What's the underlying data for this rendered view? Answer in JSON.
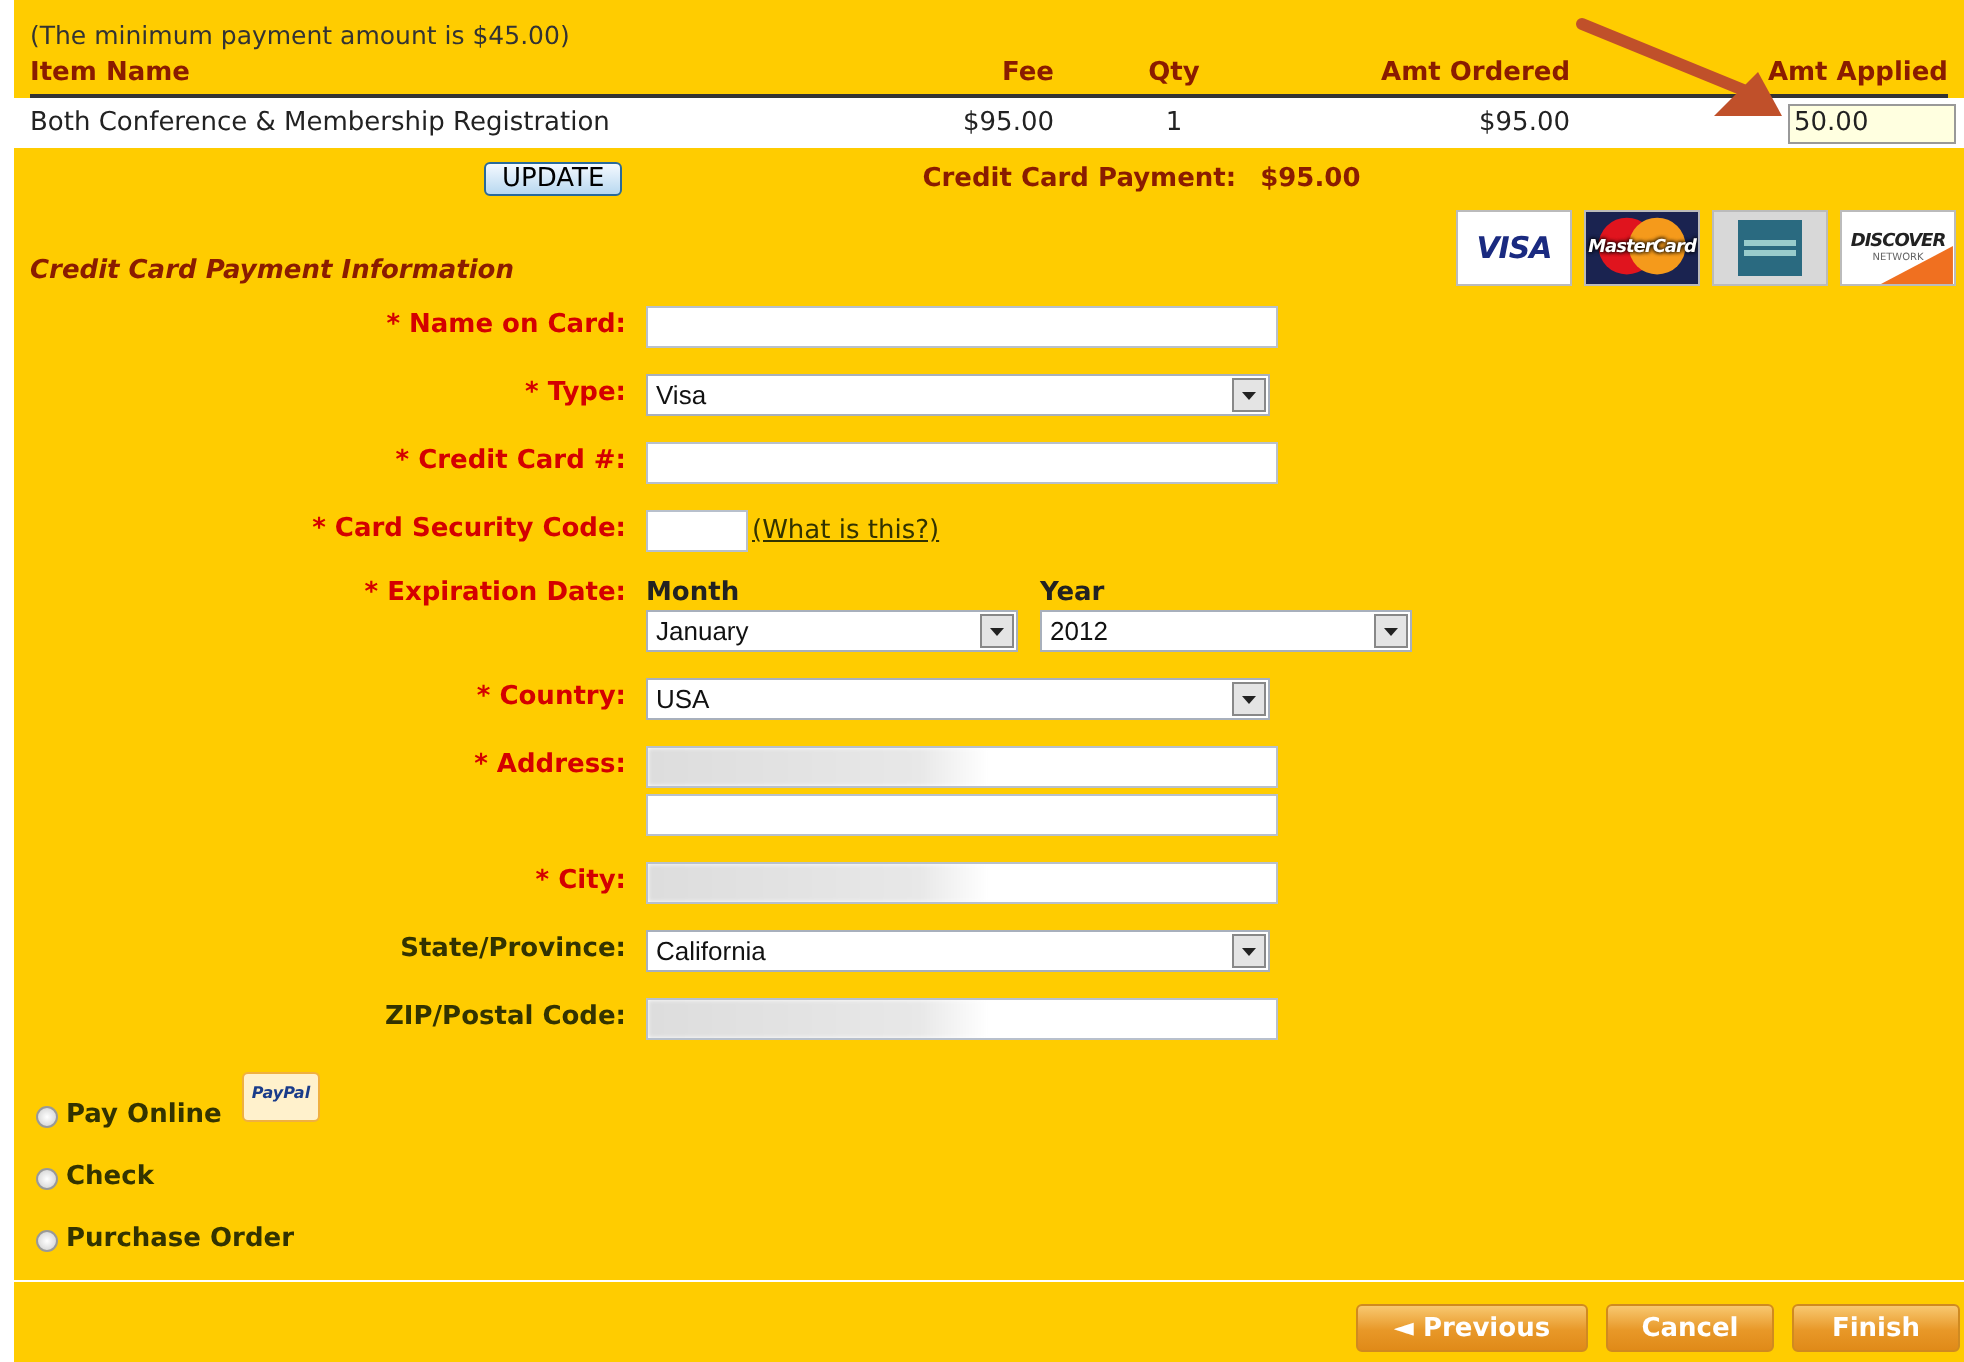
{
  "note": "(The minimum payment amount is $45.00)",
  "table": {
    "columns": [
      "Item Name",
      "Fee",
      "Qty",
      "Amt Ordered",
      "Amt Applied"
    ],
    "rows": [
      {
        "item": "Both Conference & Membership Registration",
        "fee": "$95.00",
        "qty": "1",
        "amt_ordered": "$95.00",
        "amt_applied": "50.00"
      }
    ]
  },
  "update_button": "UPDATE",
  "credit_card_payment": {
    "label": "Credit Card Payment:",
    "amount": "$95.00"
  },
  "card_logos": [
    {
      "kind": "visa",
      "text": "VISA"
    },
    {
      "kind": "mastercard",
      "text": "MasterCard"
    },
    {
      "kind": "amex"
    },
    {
      "kind": "discover",
      "text": "DISCOVER",
      "subtext": "NETWORK"
    }
  ],
  "section_title": "Credit Card Payment Information",
  "form": [
    {
      "kind": "text",
      "label": "* Name on Card:",
      "required": true,
      "blurred": false
    },
    {
      "kind": "select",
      "label": "* Type:",
      "required": true,
      "value": "Visa"
    },
    {
      "kind": "text",
      "label": "* Credit Card #:",
      "required": true,
      "blurred": false
    },
    {
      "kind": "short",
      "label": "* Card Security Code:",
      "required": true,
      "link": "(What is this?)"
    },
    {
      "kind": "date",
      "label": "* Expiration Date:",
      "required": true,
      "month_label": "Month",
      "month": "January",
      "year_label": "Year",
      "year": "2012"
    },
    {
      "kind": "select",
      "label": "* Country:",
      "required": true,
      "value": "USA"
    },
    {
      "kind": "address",
      "label": "* Address:",
      "required": true,
      "lines": [
        {
          "blurred": true
        },
        {
          "blurred": false
        }
      ]
    },
    {
      "kind": "text",
      "label": "* City:",
      "required": true,
      "blurred": true
    },
    {
      "kind": "select",
      "label": "State/Province:",
      "required": false,
      "value": "California"
    },
    {
      "kind": "text",
      "label": "ZIP/Postal Code:",
      "required": false,
      "blurred": true
    }
  ],
  "payment_methods": [
    {
      "label": "Pay Online",
      "selected": false,
      "badge": "PayPal"
    },
    {
      "label": "Check",
      "selected": false
    },
    {
      "label": "Purchase Order",
      "selected": false
    }
  ],
  "buttons": [
    {
      "label": "◄ Previous"
    },
    {
      "label": "Cancel"
    },
    {
      "label": "Finish"
    }
  ]
}
